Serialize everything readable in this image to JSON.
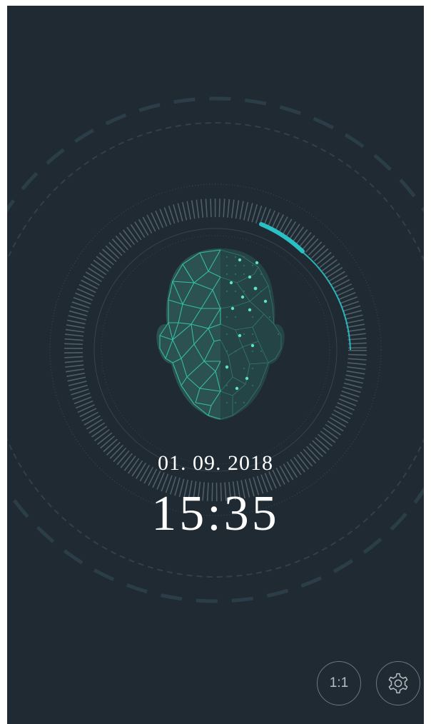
{
  "status": {
    "date": "01. 09. 2018",
    "time": "15:35"
  },
  "controls": {
    "verify_mode_label": "1:1",
    "settings_icon": "gear-icon"
  },
  "colors": {
    "background": "#1f2a33",
    "accent": "#2bc1c4",
    "mesh": "#35c2a7"
  }
}
